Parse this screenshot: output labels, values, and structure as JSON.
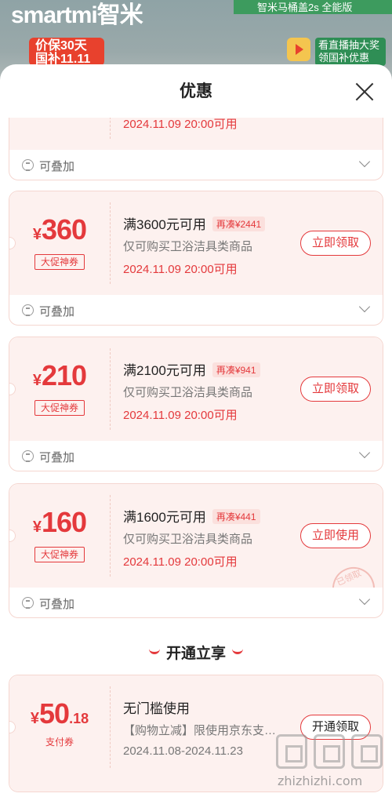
{
  "background": {
    "brand": "smartmi智米",
    "promo": "智米马桶盖2s 全能版",
    "badge_line1": "价保30天",
    "badge_line2": "国补11.11",
    "live_line1": "看直播抽大奖",
    "live_line2": "领国补优惠"
  },
  "sheet": {
    "title": "优惠"
  },
  "coupons": [
    {
      "valid": "2024.11.09 20:00可用",
      "stack": "可叠加"
    },
    {
      "currency": "¥",
      "amount": "360",
      "type": "大促神券",
      "condition": "满3600元可用",
      "gap": "再凑¥2441",
      "scope": "仅可购买卫浴洁具类商品",
      "valid": "2024.11.09 20:00可用",
      "button": "立即领取",
      "stack": "可叠加"
    },
    {
      "currency": "¥",
      "amount": "210",
      "type": "大促神券",
      "condition": "满2100元可用",
      "gap": "再凑¥941",
      "scope": "仅可购买卫浴洁具类商品",
      "valid": "2024.11.09 20:00可用",
      "button": "立即领取",
      "stack": "可叠加"
    },
    {
      "currency": "¥",
      "amount": "160",
      "type": "大促神券",
      "condition": "满1600元可用",
      "gap": "再凑¥441",
      "scope": "仅可购买卫浴洁具类商品",
      "valid": "2024.11.09 20:00可用",
      "button": "立即使用",
      "stamp": "已领取",
      "stack": "可叠加"
    }
  ],
  "section": {
    "title": "开通立享"
  },
  "pay_coupon": {
    "currency": "¥",
    "amount": "50",
    "decimal": ".18",
    "type": "支付券",
    "condition": "无门槛使用",
    "scope": "【购物立减】限使用京东支…",
    "valid": "2024.11.08-2024.11.23",
    "button": "开通领取"
  },
  "watermark": {
    "text": "zhizhizhi.com"
  }
}
